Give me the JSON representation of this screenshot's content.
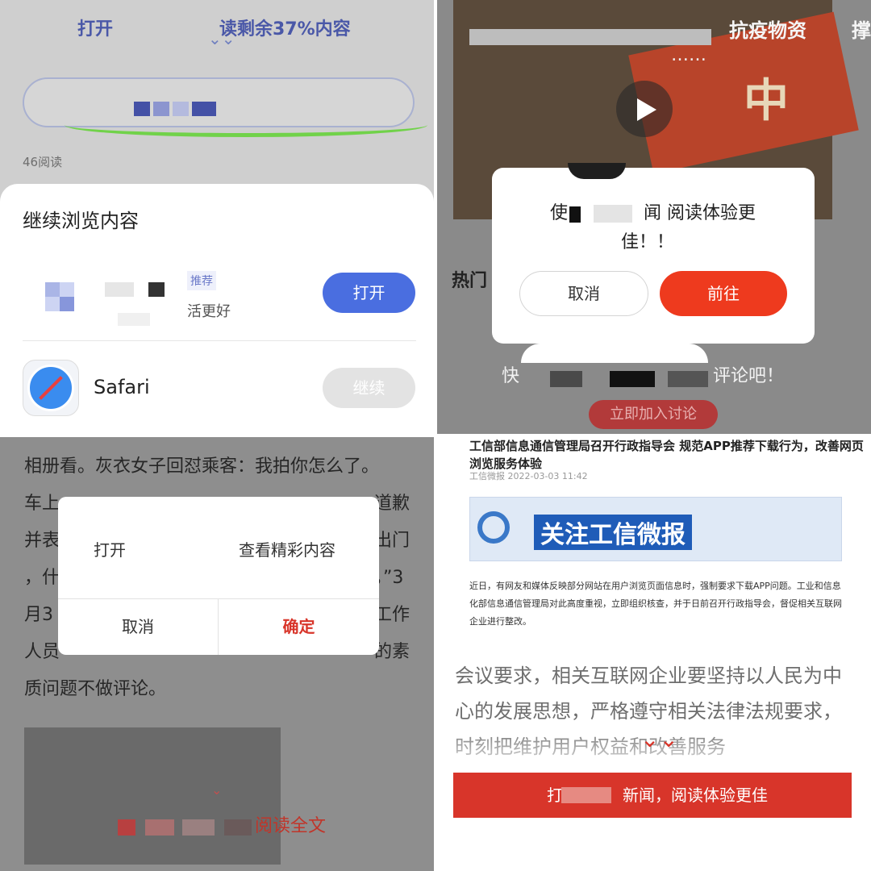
{
  "panel1": {
    "open_left": "打开",
    "open_right": "读剩余37%内容",
    "reads": "46阅读",
    "sheet_title": "继续浏览内容",
    "app_tag": "推荐",
    "app_sub": "活更好",
    "open_button": "打开",
    "safari_label": "Safari",
    "continue_button": "继续"
  },
  "panel2": {
    "tab_label": "抗疫物资",
    "tab_label2": "撑",
    "video_caption": "……",
    "hot_label": "热门",
    "dialog_msg_a": "使",
    "dialog_msg_b": "闻 阅读体验更",
    "dialog_msg_c": "佳！！",
    "cancel_button": "取消",
    "goto_button": "前往",
    "comment_tail": "评论吧！",
    "comment_head": "快",
    "join_button": "立即加入讨论"
  },
  "panel3": {
    "line1": "相册看。灰衣女子回怼乘客：我拍你怎么了。",
    "line2": "车上",
    "line2b": "道歉",
    "line3": "并表",
    "line3b": "出门",
    "line4": "，什",
    "line4b": "，”3",
    "line5": "月3",
    "line5b": "工作",
    "line6": "人员",
    "line6b": "的素",
    "line7": "质问题不做评论。",
    "dialog_open": "打开",
    "dialog_view": "查看精彩内容",
    "cancel_button": "取消",
    "ok_button": "确定",
    "read_all": "阅读全文"
  },
  "panel4": {
    "headline": "工信部信息通信管理局召开行政指导会 规范APP推荐下载行为，改善网页浏览服务体验",
    "source": "工信微报  2022-03-03 11:42",
    "banner_text": "关注工信微报",
    "small_p1": "近日，有网友和媒体反映部分网站在用户浏览页面信息时，强制要求下载APP问题。工业和信息化部信息通信管理局对此高度重视，立即组织核查，并于日前召开行政指导会，督促相关互联网企业进行整改。",
    "big_p1": "会议要求，相关互联网企业要坚持以人民为中心的发展思想，严格遵守相关法律法规要求，时刻把维护用户权益和改善服务",
    "redbar_text": "新闻，阅读体验更佳",
    "redbar_prefix": "打"
  },
  "colors": {
    "accent_blue": "#4a6ee0",
    "accent_red": "#d8352a",
    "accent_orange": "#ee3a1e",
    "scribble_green": "#71d24a"
  },
  "icons": [
    "chevron-down-icon",
    "app-icon",
    "safari-icon",
    "play-icon"
  ]
}
